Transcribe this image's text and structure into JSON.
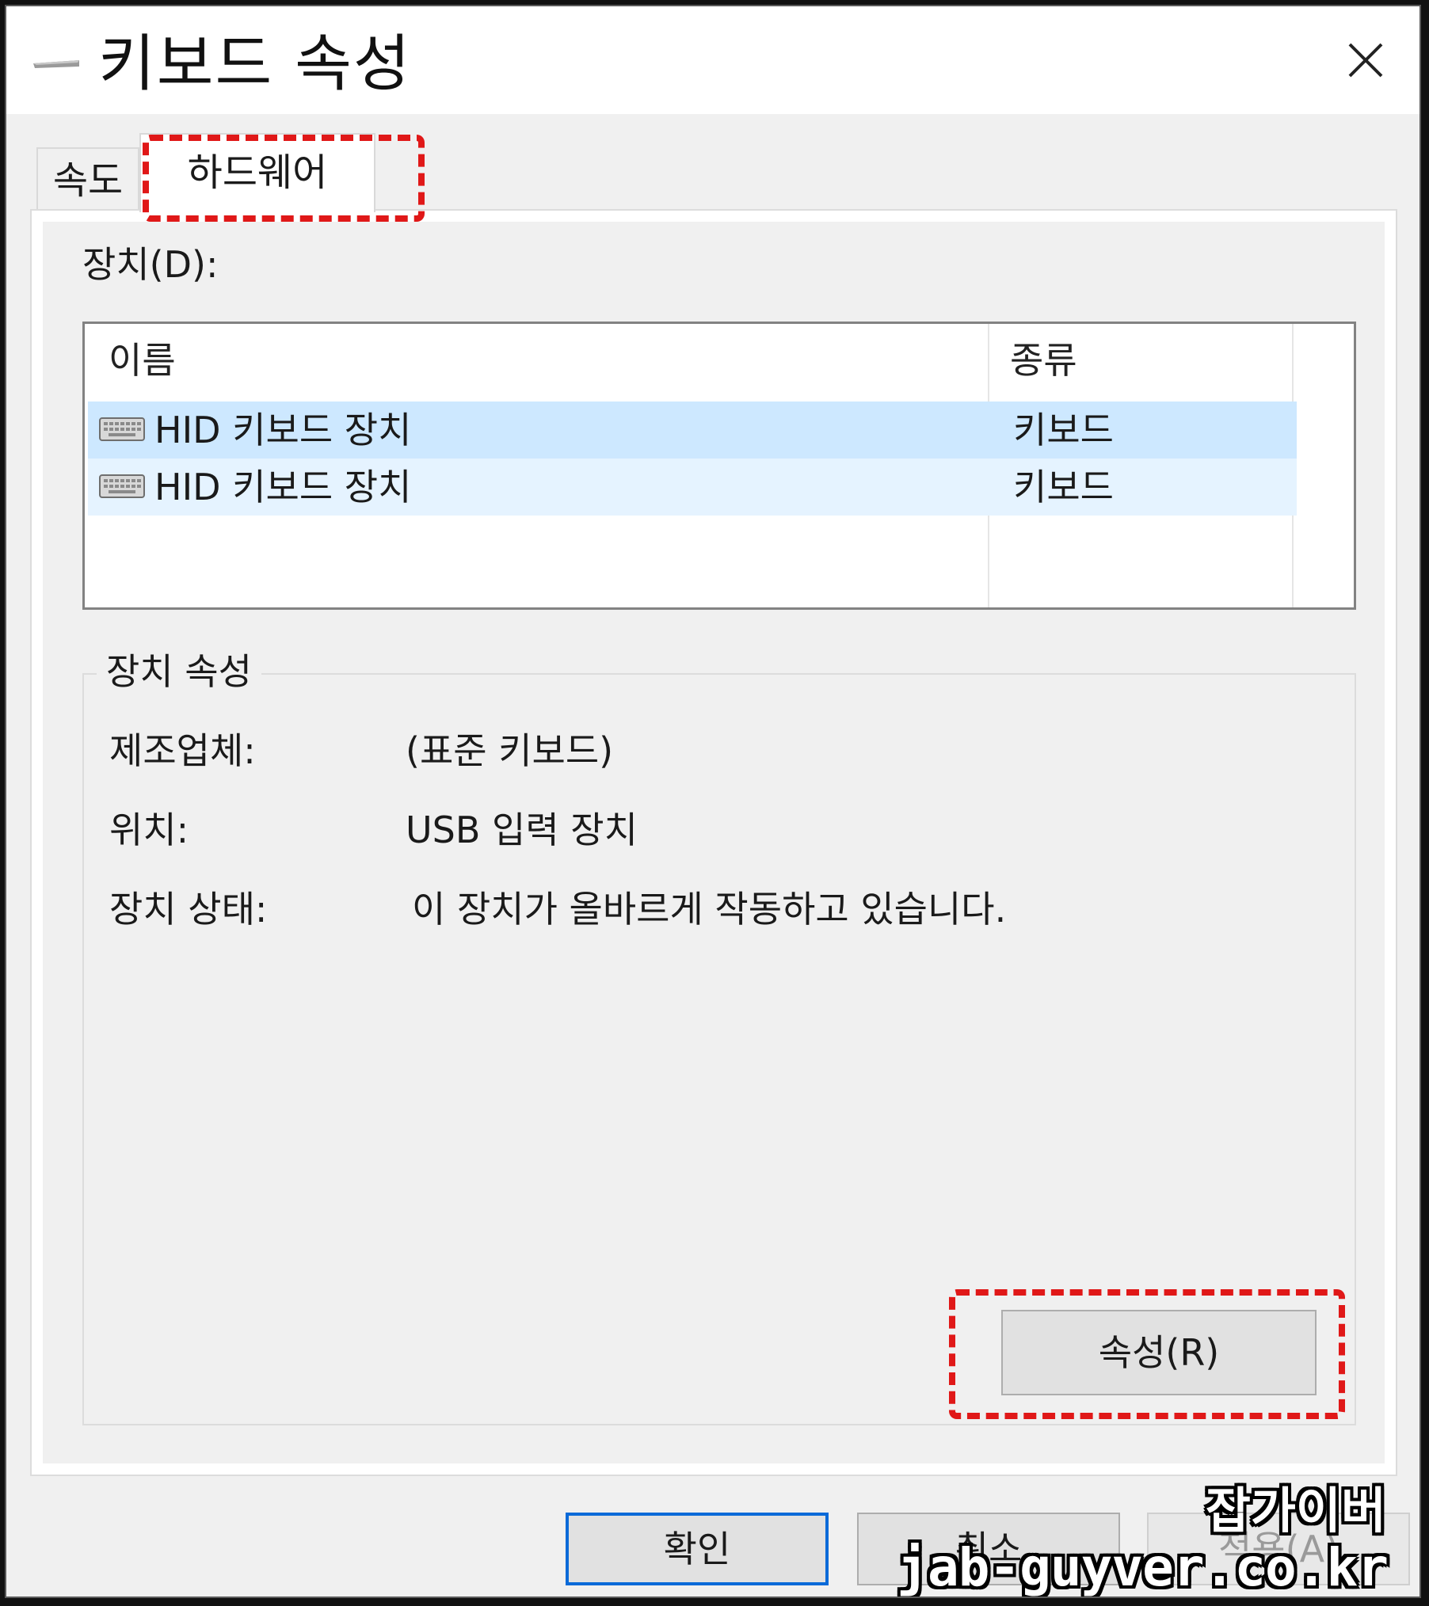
{
  "window": {
    "title": "키보드 속성",
    "icon": "keyboard-icon",
    "close_icon": "close-icon"
  },
  "tabs": [
    {
      "label": "속도",
      "selected": false
    },
    {
      "label": "하드웨어",
      "selected": true
    }
  ],
  "devices": {
    "label": "장치(D):",
    "columns": [
      "이름",
      "종류"
    ],
    "rows": [
      {
        "name": "HID 키보드 장치",
        "type": "키보드",
        "icon": "keyboard-icon"
      },
      {
        "name": "HID 키보드 장치",
        "type": "키보드",
        "icon": "keyboard-icon"
      }
    ]
  },
  "device_properties": {
    "legend": "장치 속성",
    "manufacturer_label": "제조업체:",
    "manufacturer_value": "(표준 키보드)",
    "location_label": "위치:",
    "location_value": "USB 입력 장치",
    "status_label": "장치 상태:",
    "status_value": "이 장치가 올바르게 작동하고 있습니다.",
    "properties_button": "속성(R)"
  },
  "footer": {
    "ok_label": "확인",
    "cancel_label": "취소",
    "apply_label": "적용(A)"
  },
  "annotations": {
    "highlight_color": "#e01818"
  },
  "watermark": {
    "name": "잡가이버",
    "url": "jab-guyver.co.kr"
  }
}
